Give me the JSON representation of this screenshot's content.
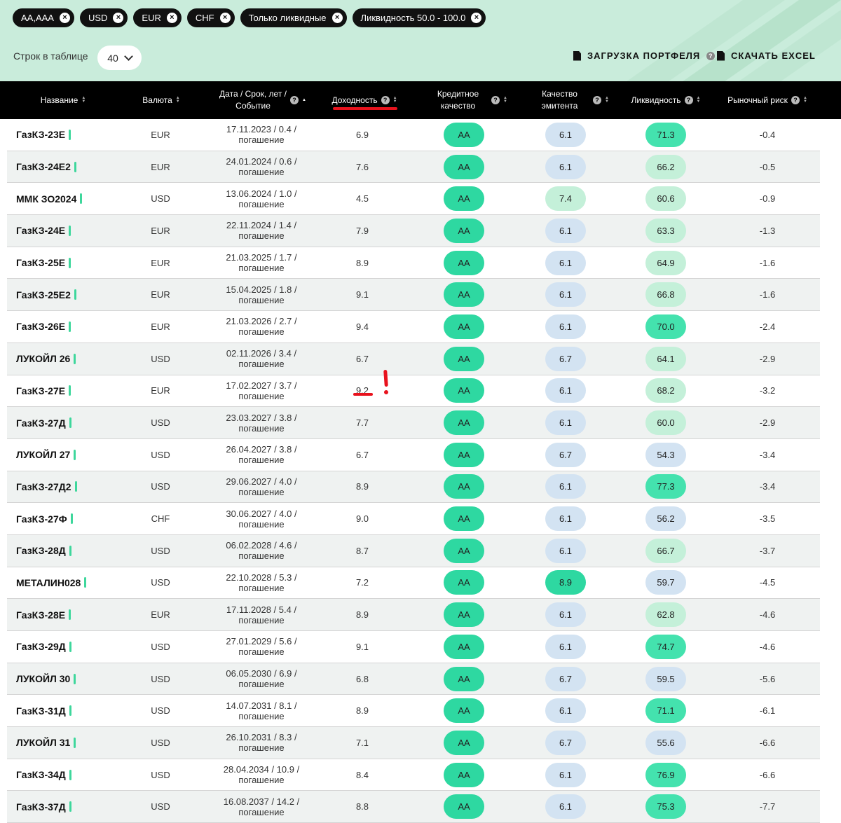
{
  "filters": [
    {
      "label": "AA,AAA"
    },
    {
      "label": "USD"
    },
    {
      "label": "EUR"
    },
    {
      "label": "CHF"
    },
    {
      "label": "Только ликвидные"
    },
    {
      "label": "Ликвидность 50.0 - 100.0"
    }
  ],
  "controls": {
    "rows_label": "Строк в таблице",
    "rows_value": "40",
    "load_portfolio": "ЗАГРУЗКА ПОРТФЕЛЯ",
    "download_excel": "СКАЧАТЬ EXCEL"
  },
  "columns": {
    "name": "Название",
    "currency": "Валюта",
    "date_line1": "Дата / Срок, лет /",
    "date_line2": "Событие",
    "yield": "Доходность",
    "credit_line1": "Кредитное",
    "credit_line2": "качество",
    "issuer_line1": "Качество",
    "issuer_line2": "эмитента",
    "liquidity": "Ликвидность",
    "risk": "Рыночный риск"
  },
  "colors": {
    "accent_green": "#3ed79c",
    "credit_pill": "#2ed8a1",
    "issuer_blue": "#d3e3f2",
    "issuer_light_green": "#c4f0d9",
    "issuer_green": "#2ed8a1",
    "liq_strong": "#44e2ae",
    "liq_light": "#c4f0d9",
    "liq_blue": "#d3e3f2",
    "annotation_red": "#e8121d"
  },
  "rows": [
    {
      "name": "ГазКЗ-23Е",
      "currency": "EUR",
      "date": "17.11.2023 / 0.4 /",
      "event": "погашение",
      "yield": "6.9",
      "credit": "AA",
      "issuer": "6.1",
      "issuer_tone": "blue",
      "liquidity": "71.3",
      "liq_tone": "strong",
      "risk": "-0.4"
    },
    {
      "name": "ГазКЗ-24Е2",
      "currency": "EUR",
      "date": "24.01.2024 / 0.6 /",
      "event": "погашение",
      "yield": "7.6",
      "credit": "AA",
      "issuer": "6.1",
      "issuer_tone": "blue",
      "liquidity": "66.2",
      "liq_tone": "light",
      "risk": "-0.5"
    },
    {
      "name": "ММК ЗО2024",
      "currency": "USD",
      "date": "13.06.2024 / 1.0 /",
      "event": "погашение",
      "yield": "4.5",
      "credit": "AA",
      "issuer": "7.4",
      "issuer_tone": "lightgreen",
      "liquidity": "60.6",
      "liq_tone": "light",
      "risk": "-0.9"
    },
    {
      "name": "ГазКЗ-24Е",
      "currency": "EUR",
      "date": "22.11.2024 / 1.4 /",
      "event": "погашение",
      "yield": "7.9",
      "credit": "AA",
      "issuer": "6.1",
      "issuer_tone": "blue",
      "liquidity": "63.3",
      "liq_tone": "light",
      "risk": "-1.3"
    },
    {
      "name": "ГазКЗ-25Е",
      "currency": "EUR",
      "date": "21.03.2025 / 1.7 /",
      "event": "погашение",
      "yield": "8.9",
      "credit": "AA",
      "issuer": "6.1",
      "issuer_tone": "blue",
      "liquidity": "64.9",
      "liq_tone": "light",
      "risk": "-1.6"
    },
    {
      "name": "ГазКЗ-25Е2",
      "currency": "EUR",
      "date": "15.04.2025 / 1.8 /",
      "event": "погашение",
      "yield": "9.1",
      "credit": "AA",
      "issuer": "6.1",
      "issuer_tone": "blue",
      "liquidity": "66.8",
      "liq_tone": "light",
      "risk": "-1.6"
    },
    {
      "name": "ГазКЗ-26Е",
      "currency": "EUR",
      "date": "21.03.2026 / 2.7 /",
      "event": "погашение",
      "yield": "9.4",
      "credit": "AA",
      "issuer": "6.1",
      "issuer_tone": "blue",
      "liquidity": "70.0",
      "liq_tone": "strong",
      "risk": "-2.4"
    },
    {
      "name": "ЛУКОЙЛ 26",
      "currency": "USD",
      "date": "02.11.2026 / 3.4 /",
      "event": "погашение",
      "yield": "6.7",
      "credit": "AA",
      "issuer": "6.7",
      "issuer_tone": "blue",
      "liquidity": "64.1",
      "liq_tone": "light",
      "risk": "-2.9"
    },
    {
      "name": "ГазКЗ-27Е",
      "currency": "EUR",
      "date": "17.02.2027 / 3.7 /",
      "event": "погашение",
      "yield": "9.2",
      "credit": "AA",
      "issuer": "6.1",
      "issuer_tone": "blue",
      "liquidity": "68.2",
      "liq_tone": "light",
      "risk": "-3.2"
    },
    {
      "name": "ГазКЗ-27Д",
      "currency": "USD",
      "date": "23.03.2027 / 3.8 /",
      "event": "погашение",
      "yield": "7.7",
      "credit": "AA",
      "issuer": "6.1",
      "issuer_tone": "blue",
      "liquidity": "60.0",
      "liq_tone": "light",
      "risk": "-2.9"
    },
    {
      "name": "ЛУКОЙЛ 27",
      "currency": "USD",
      "date": "26.04.2027 / 3.8 /",
      "event": "погашение",
      "yield": "6.7",
      "credit": "AA",
      "issuer": "6.7",
      "issuer_tone": "blue",
      "liquidity": "54.3",
      "liq_tone": "blue",
      "risk": "-3.4"
    },
    {
      "name": "ГазКЗ-27Д2",
      "currency": "USD",
      "date": "29.06.2027 / 4.0 /",
      "event": "погашение",
      "yield": "8.9",
      "credit": "AA",
      "issuer": "6.1",
      "issuer_tone": "blue",
      "liquidity": "77.3",
      "liq_tone": "strong",
      "risk": "-3.4"
    },
    {
      "name": "ГазКЗ-27Ф",
      "currency": "CHF",
      "date": "30.06.2027 / 4.0 /",
      "event": "погашение",
      "yield": "9.0",
      "credit": "AA",
      "issuer": "6.1",
      "issuer_tone": "blue",
      "liquidity": "56.2",
      "liq_tone": "blue",
      "risk": "-3.5"
    },
    {
      "name": "ГазКЗ-28Д",
      "currency": "USD",
      "date": "06.02.2028 / 4.6 /",
      "event": "погашение",
      "yield": "8.7",
      "credit": "AA",
      "issuer": "6.1",
      "issuer_tone": "blue",
      "liquidity": "66.7",
      "liq_tone": "light",
      "risk": "-3.7"
    },
    {
      "name": "МЕТАЛИН028",
      "currency": "USD",
      "date": "22.10.2028 / 5.3 /",
      "event": "погашение",
      "yield": "7.2",
      "credit": "AA",
      "issuer": "8.9",
      "issuer_tone": "green",
      "liquidity": "59.7",
      "liq_tone": "blue",
      "risk": "-4.5"
    },
    {
      "name": "ГазКЗ-28Е",
      "currency": "EUR",
      "date": "17.11.2028 / 5.4 /",
      "event": "погашение",
      "yield": "8.9",
      "credit": "AA",
      "issuer": "6.1",
      "issuer_tone": "blue",
      "liquidity": "62.8",
      "liq_tone": "light",
      "risk": "-4.6"
    },
    {
      "name": "ГазКЗ-29Д",
      "currency": "USD",
      "date": "27.01.2029 / 5.6 /",
      "event": "погашение",
      "yield": "9.1",
      "credit": "AA",
      "issuer": "6.1",
      "issuer_tone": "blue",
      "liquidity": "74.7",
      "liq_tone": "strong",
      "risk": "-4.6"
    },
    {
      "name": "ЛУКОЙЛ 30",
      "currency": "USD",
      "date": "06.05.2030 / 6.9 /",
      "event": "погашение",
      "yield": "6.8",
      "credit": "AA",
      "issuer": "6.7",
      "issuer_tone": "blue",
      "liquidity": "59.5",
      "liq_tone": "blue",
      "risk": "-5.6"
    },
    {
      "name": "ГазКЗ-31Д",
      "currency": "USD",
      "date": "14.07.2031 / 8.1 /",
      "event": "погашение",
      "yield": "8.9",
      "credit": "AA",
      "issuer": "6.1",
      "issuer_tone": "blue",
      "liquidity": "71.1",
      "liq_tone": "strong",
      "risk": "-6.1"
    },
    {
      "name": "ЛУКОЙЛ 31",
      "currency": "USD",
      "date": "26.10.2031 / 8.3 /",
      "event": "погашение",
      "yield": "7.1",
      "credit": "AA",
      "issuer": "6.7",
      "issuer_tone": "blue",
      "liquidity": "55.6",
      "liq_tone": "blue",
      "risk": "-6.6"
    },
    {
      "name": "ГазКЗ-34Д",
      "currency": "USD",
      "date": "28.04.2034 / 10.9 /",
      "event": "погашение",
      "yield": "8.4",
      "credit": "AA",
      "issuer": "6.1",
      "issuer_tone": "blue",
      "liquidity": "76.9",
      "liq_tone": "strong",
      "risk": "-6.6"
    },
    {
      "name": "ГазКЗ-37Д",
      "currency": "USD",
      "date": "16.08.2037 / 14.2 /",
      "event": "погашение",
      "yield": "8.8",
      "credit": "AA",
      "issuer": "6.1",
      "issuer_tone": "blue",
      "liquidity": "75.3",
      "liq_tone": "strong",
      "risk": "-7.7"
    }
  ],
  "annotation": {
    "text": "!"
  }
}
